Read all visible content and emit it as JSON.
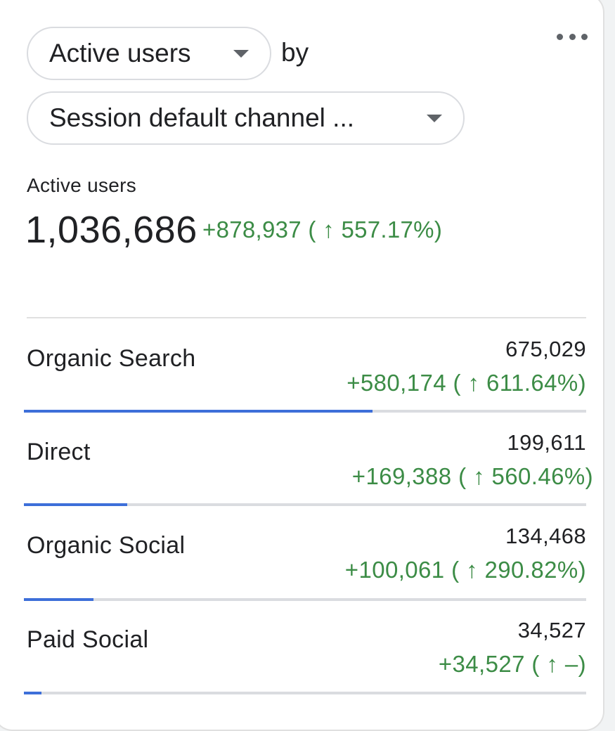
{
  "card": {
    "metric_selector": {
      "label": "Active users"
    },
    "by_label": "by",
    "dimension_selector": {
      "label": "Session default channel ..."
    },
    "metric_label": "Active users",
    "total_value": "1,036,686",
    "total_delta": "+878,937 ( ↑ 557.17%)",
    "accent_color": "#3d6fd9",
    "positive_color": "#3c8c46"
  },
  "rows": [
    {
      "name": "Organic Search",
      "value": "675,029",
      "delta": "+580,174 ( ↑ 611.64%)",
      "share": 0.651
    },
    {
      "name": "Direct",
      "value": "199,611",
      "delta": "+169,388 ( ↑ 560.46%)",
      "share": 0.193
    },
    {
      "name": "Organic Social",
      "value": "134,468",
      "delta": "+100,061 ( ↑ 290.82%)",
      "share": 0.13
    },
    {
      "name": "Paid Social",
      "value": "34,527",
      "delta": "+34,527 ( ↑ –)",
      "share": 0.033
    }
  ]
}
